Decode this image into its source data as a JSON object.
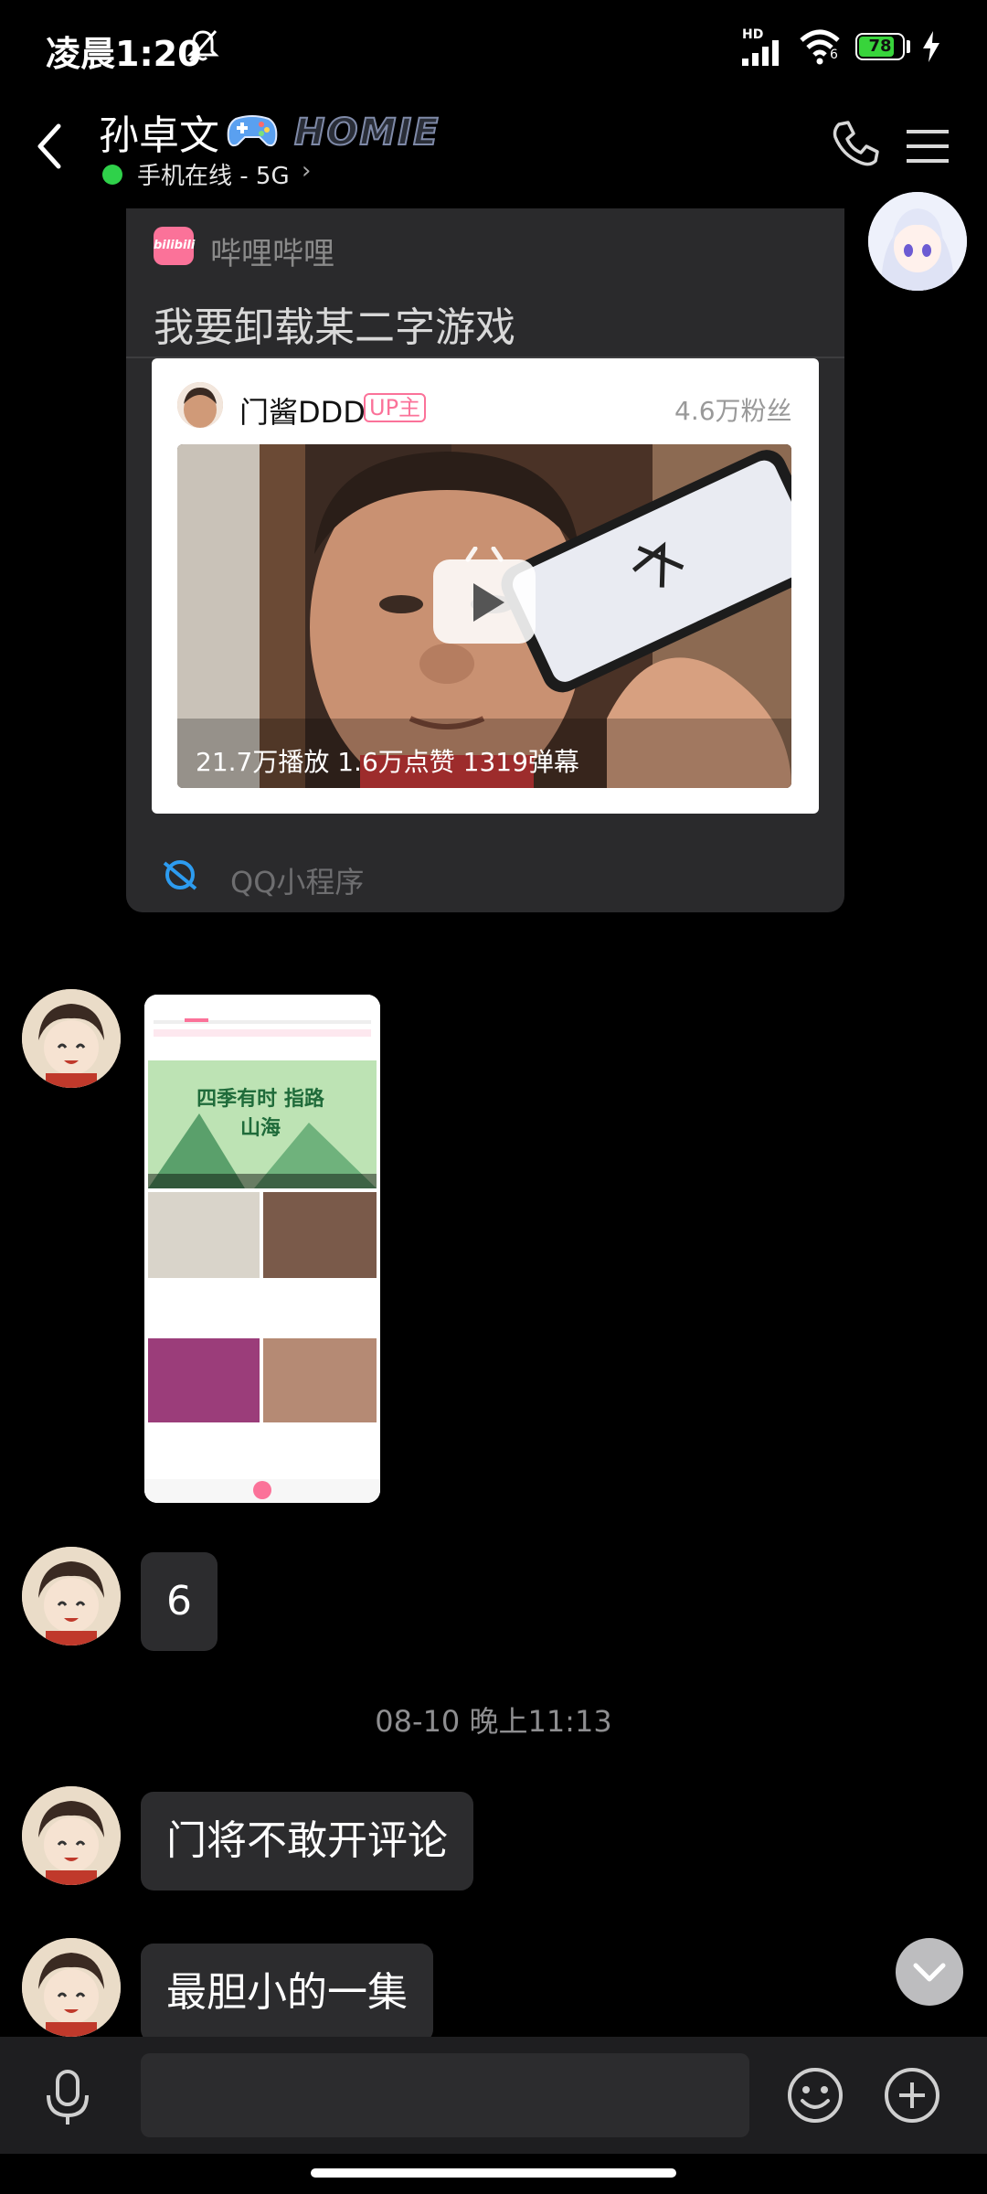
{
  "status_bar": {
    "time": "凌晨1:20",
    "hd_label": "HD",
    "signal_gen": "",
    "wifi_gen": "6",
    "battery": "78"
  },
  "header": {
    "contact_name": "孙卓文",
    "badge_text": "HOMIE",
    "online_status": "手机在线 - 5G",
    "online_chevron": "›"
  },
  "mini_program": {
    "app_name": "哔哩哔哩",
    "title": "我要卸载某二字游戏",
    "uploader": "门酱DDD",
    "uploader_tag": "UP主",
    "fans": "4.6万粉丝",
    "stats": "21.7万播放  1.6万点赞  1319弹幕",
    "footer": "QQ小程序",
    "logo_text": "bilibili"
  },
  "screenshot_message": {
    "caption_banner": "四季有时 指路山海"
  },
  "messages": [
    {
      "text": "6"
    },
    {
      "text": "门将不敢开评论"
    },
    {
      "text": "最胆小的一集"
    }
  ],
  "timestamp": "08-10 晚上11:13",
  "input": {
    "placeholder": "",
    "value": ""
  },
  "colors": {
    "background": "#000000",
    "bubble": "#2c2c2e",
    "bilibili_pink": "#fb7299",
    "online_green": "#2fd14a",
    "battery_green": "#38d43b"
  }
}
